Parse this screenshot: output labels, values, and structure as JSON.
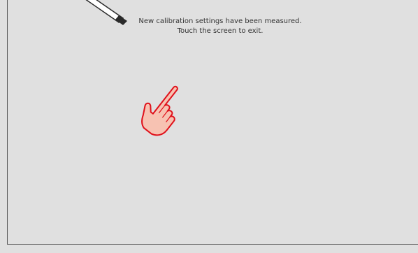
{
  "calibration": {
    "message_line1": "New calibration settings have been measured.",
    "message_line2": "Touch the screen to exit."
  },
  "icons": {
    "pointer": "stylus-pointer-icon",
    "hand": "touch-hand-icon"
  },
  "colors": {
    "background": "#e0e0e0",
    "frame": "#5a5a5a",
    "text": "#333333",
    "hand_outline": "#e0101a",
    "hand_fill": "#f7c2b2",
    "pointer_fill": "#ffffff",
    "pointer_outline": "#2a2a2a"
  }
}
